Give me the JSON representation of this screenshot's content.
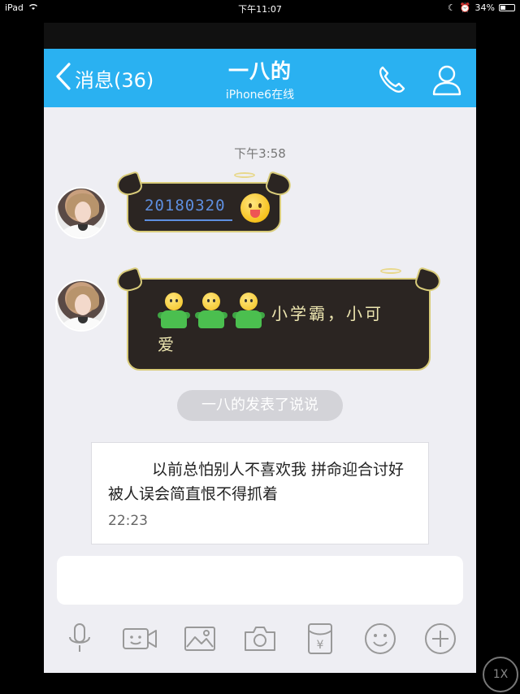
{
  "device_status": {
    "carrier": "iPad",
    "time": "下午11:07",
    "battery": "34%",
    "battery_level": 0.34
  },
  "navbar": {
    "back_label": "消息(36)",
    "contact_name": "一八的",
    "contact_status": "iPhone6在线",
    "icons": [
      "chevron-left-icon",
      "phone-icon",
      "profile-icon"
    ]
  },
  "conversation": {
    "timestamp": "下午3:58",
    "messages": [
      {
        "sender": "contact",
        "text": "20180320",
        "emoji": "tongue-out-face"
      },
      {
        "sender": "contact",
        "text_line1": "小学霸，小可",
        "text_line2": "爱",
        "emoji": "green-man x3"
      }
    ],
    "system_notice": "一八的发表了说说",
    "feed_post": {
      "text": "以前总怕别人不喜欢我 拼命迎合讨好 被人误会简直恨不得抓着",
      "time": "22:23"
    }
  },
  "toolbar": {
    "icons": [
      "microphone-icon",
      "video-icon",
      "image-icon",
      "camera-icon",
      "red-packet-icon",
      "emoji-icon",
      "plus-icon"
    ]
  },
  "zoom_button": "1X",
  "colors": {
    "navbar": "#2ab1f1",
    "chat_bg": "#eeeef3",
    "bubble_bg": "#2b2522",
    "bubble_border": "#d9cc7a"
  }
}
